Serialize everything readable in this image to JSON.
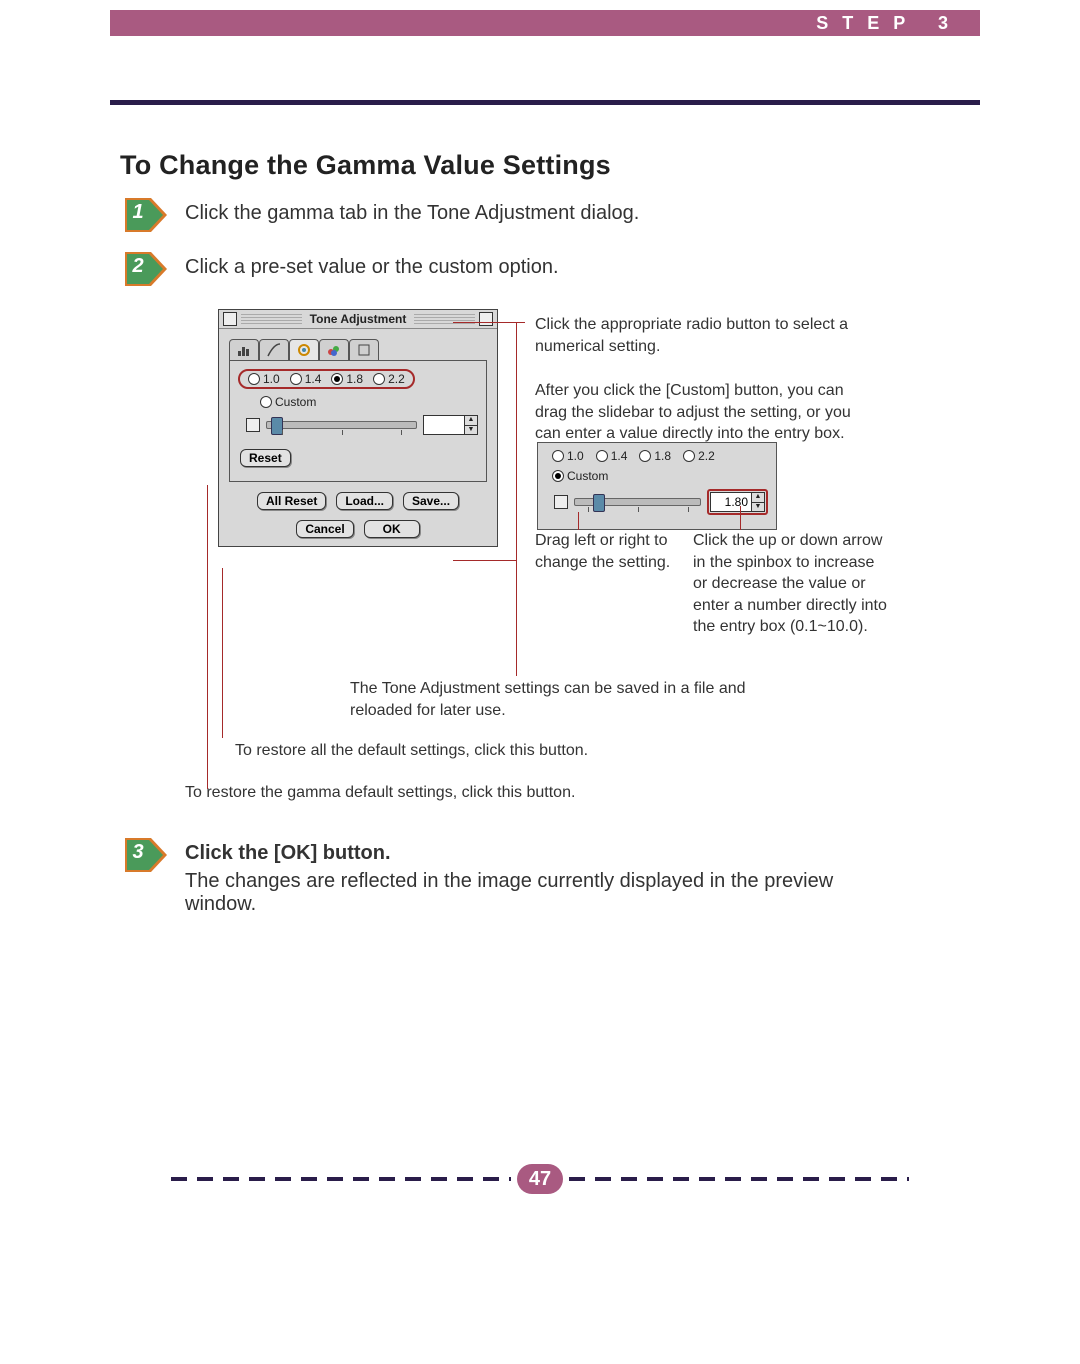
{
  "header": {
    "step_label": "STEP 3"
  },
  "title": "To Change the Gamma Value Settings",
  "steps": {
    "s1": {
      "num": "1",
      "text": "Click the gamma tab in the Tone Adjustment dialog."
    },
    "s2": {
      "num": "2",
      "text": "Click a pre-set value or the custom option."
    },
    "s3": {
      "num": "3",
      "heading": "Click the [OK] button.",
      "body": "The changes are reflected in the image currently displayed in the preview window."
    }
  },
  "dialog": {
    "title": "Tone Adjustment",
    "radios": {
      "r1": "1.0",
      "r2": "1.4",
      "r3": "1.8",
      "r4": "2.2"
    },
    "selected_main": "1.8",
    "custom_label": "Custom",
    "reset": "Reset",
    "all_reset": "All Reset",
    "load": "Load...",
    "save": "Save...",
    "cancel": "Cancel",
    "ok": "OK"
  },
  "panel2": {
    "selected": "Custom",
    "spin_value": "1.80"
  },
  "annotations": {
    "radio_hint": "Click the appropriate radio button to select a numerical setting.",
    "custom_hint": "After you click the [Custom] button, you can drag the slidebar to adjust the setting, or you can enter a value directly into the entry box.",
    "drag_hint": "Drag left or right to change the setting.",
    "spin_hint": "Click the up or down arrow in the spinbox to increase or decrease the value or enter a number directly into the entry box (0.1~10.0).",
    "save_hint": "The Tone Adjustment settings can be saved in a file and reloaded for later use.",
    "all_reset_hint": "To restore all the default settings, click this button.",
    "reset_hint": "To restore the gamma default settings, click this button."
  },
  "page_number": "47"
}
